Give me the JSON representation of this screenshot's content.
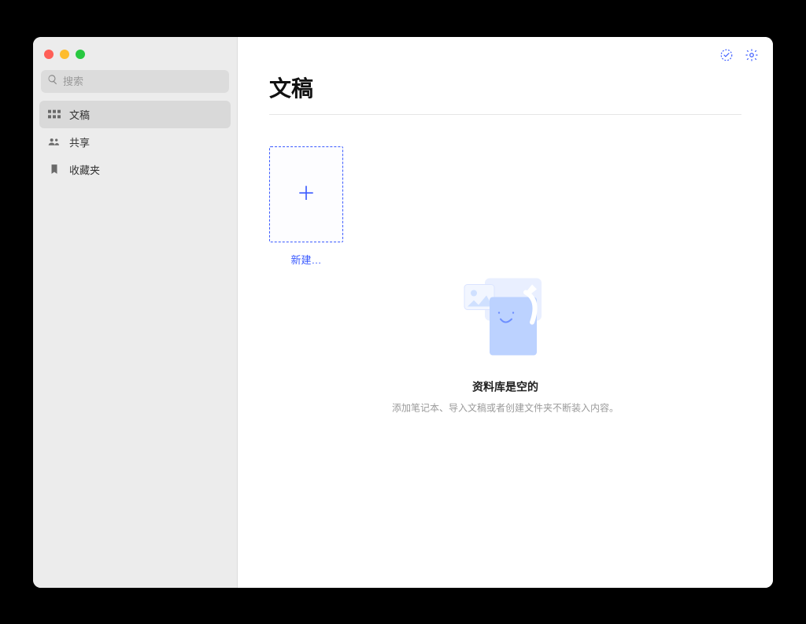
{
  "search": {
    "placeholder": "搜索"
  },
  "sidebar": {
    "items": [
      {
        "label": "文稿",
        "icon": "grid-icon"
      },
      {
        "label": "共享",
        "icon": "people-icon"
      },
      {
        "label": "收藏夹",
        "icon": "bookmark-icon"
      }
    ]
  },
  "header": {
    "title": "文稿"
  },
  "new_card": {
    "label": "新建…",
    "plus": "＋"
  },
  "empty_state": {
    "title": "资料库是空的",
    "subtitle": "添加笔记本、导入文稿或者创建文件夹不断装入内容。"
  },
  "colors": {
    "accent": "#3b5bff"
  }
}
